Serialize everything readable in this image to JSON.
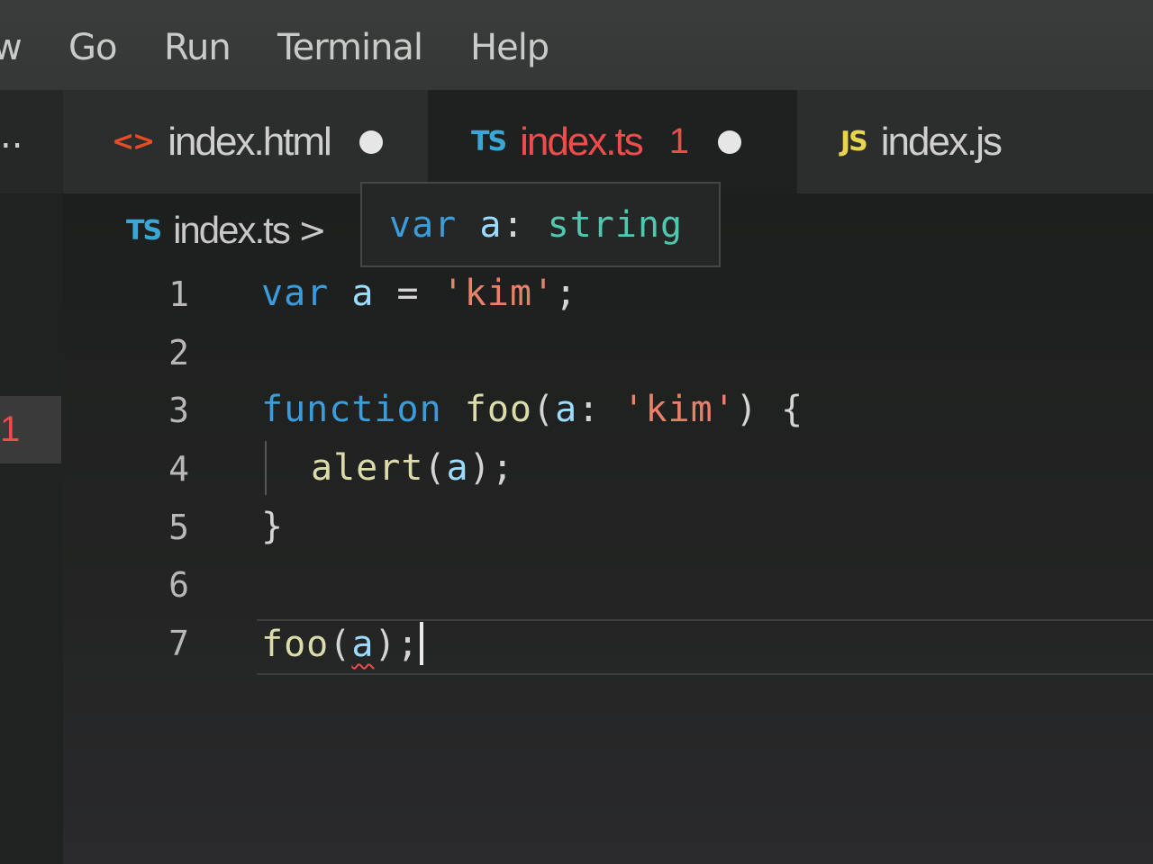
{
  "menu": {
    "items": [
      "w",
      "Go",
      "Run",
      "Terminal",
      "Help"
    ]
  },
  "tabs": [
    {
      "icon": "<>",
      "label": "index.html",
      "dirty": true
    },
    {
      "icon": "TS",
      "label": "index.ts",
      "problems": "1",
      "dirty": true
    },
    {
      "icon": "JS",
      "label": "index.js"
    }
  ],
  "sidebar": {
    "left_dots": "..",
    "badge": "1"
  },
  "breadcrumb": {
    "icon": "TS",
    "file": "index.ts",
    "chevron": ">"
  },
  "hover": {
    "kw": "var",
    "name": "a",
    "colon": ":",
    "type": "string"
  },
  "code": {
    "line_numbers": [
      "1",
      "2",
      "3",
      "4",
      "5",
      "6",
      "7"
    ],
    "l1": {
      "kw": "var",
      "name": "a",
      "op": "=",
      "str": "'kim'",
      "end": ";"
    },
    "l3": {
      "kw": "function",
      "fn": "foo",
      "open": "(",
      "param": "a",
      "colon": ":",
      "type": "'kim'",
      "close": ")",
      "brace": "{"
    },
    "l4": {
      "fn": "alert",
      "open": "(",
      "arg": "a",
      "close": ");"
    },
    "l5": {
      "brace": "}"
    },
    "l7": {
      "fn": "foo",
      "open": "(",
      "arg": "a",
      "close": ");"
    }
  },
  "colors": {
    "keyword": "#3b9cdc",
    "function": "#dcdcaa",
    "variable": "#9cdcfe",
    "string": "#e8806a",
    "type": "#4ec9b0",
    "error": "#f14c4c",
    "ts_icon": "#3aa8d6",
    "js_icon": "#e8d44d",
    "html_icon": "#e44d26"
  }
}
